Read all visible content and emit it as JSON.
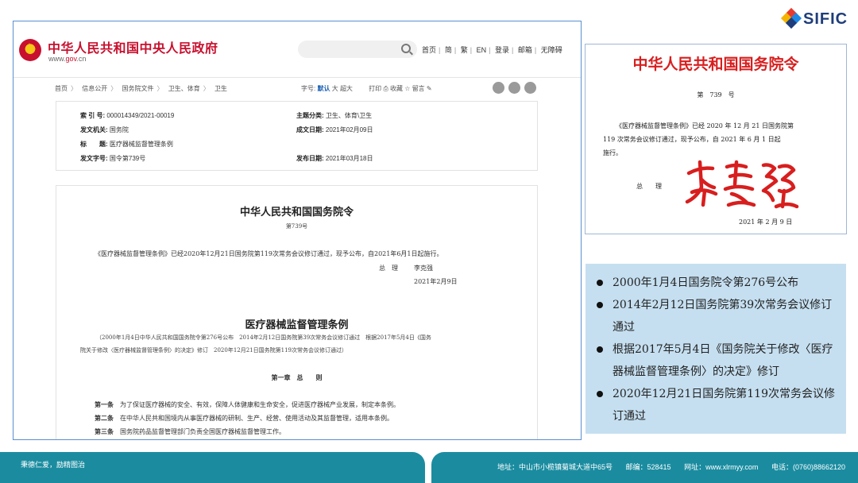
{
  "gov_site": {
    "title": "中华人民共和国中央人民政府",
    "url_prefix": "www.",
    "url_gov": "gov",
    "url_suffix": ".cn",
    "nav_links": [
      "首页",
      "简",
      "繁",
      "EN",
      "登录",
      "邮箱",
      "无障碍"
    ],
    "breadcrumbs": [
      "首页",
      "信息公开",
      "国务院文件",
      "卫生、体育",
      "卫生"
    ],
    "font_size_label": "字号:",
    "font_sizes": [
      "默认",
      "大",
      "超大"
    ],
    "tools": [
      "打印",
      "收藏",
      "留言"
    ]
  },
  "meta": {
    "index_label": "索 引 号:",
    "index_value": "000014349/2021-00019",
    "category_label": "主题分类:",
    "category_value": "卫生、体育\\卫生",
    "issuer_label": "发文机关:",
    "issuer_value": "国务院",
    "written_label": "成文日期:",
    "written_value": "2021年02月09日",
    "title_label": "标　　题:",
    "title_value": "医疗器械监督管理条例",
    "docno_label": "发文字号:",
    "docno_value": "国令第739号",
    "published_label": "发布日期:",
    "published_value": "2021年03月18日"
  },
  "document": {
    "heading": "中华人民共和国国务院令",
    "number": "第739号",
    "intro": "《医疗器械监督管理条例》已经2020年12月21日国务院第119次常务会议修订通过，现予公布，自2021年6月1日起施行。",
    "signer_label": "总　理",
    "signer_name": "李克强",
    "sign_date": "2021年2月9日",
    "regulation_title": "医疗器械监督管理条例",
    "history_line1": "（2000年1月4日中华人民共和国国务院令第276号公布　2014年2月12日国务院第39次常务会议修订通过　根据2017年5月4日《国务",
    "history_line2": "院关于修改〈医疗器械监督管理条例〉的决定》修订　2020年12月21日国务院第119次常务会议修订通过）",
    "chapter": "第一章　总　　则",
    "articles": [
      {
        "label": "第一条",
        "text": "为了保证医疗器械的安全、有效，保障人体健康和生命安全，促进医疗器械产业发展，制定本条例。"
      },
      {
        "label": "第二条",
        "text": "在中华人民共和国境内从事医疗器械的研制、生产、经营、使用活动及其监督管理，适用本条例。"
      },
      {
        "label": "第三条",
        "text": "国务院药品监督管理部门负责全国医疗器械监督管理工作。"
      }
    ]
  },
  "logo": {
    "text": "SIFIC",
    "colors": [
      "#e63b2e",
      "#f4b400",
      "#1e88e5",
      "#1e3d7a"
    ]
  },
  "decree": {
    "title": "中华人民共和国国务院令",
    "number": "第　739　号",
    "body_line1": "《医疗器械监督管理条例》已经 2020 年 12 月 21 日国务院第",
    "body_line2": "119 次常务会议修订通过，现予公布，自 2021 年 6 月 1 日起",
    "body_line3": "施行。",
    "signer_label": "总　　理",
    "date": "2021 年 2 月 9 日",
    "signature_color": "#d81e1e"
  },
  "info_panel": {
    "items": [
      {
        "text": "2000年1月4日国务院令第276号公布"
      },
      {
        "text": "2014年2月12日国务院第39次常务会议修订通过"
      },
      {
        "text": "根据2017年5月4日《国务院关于修改〈医疗器械监督管理条例〉的决定》修订"
      },
      {
        "text": "2020年12月21日国务院第119次常务会议修订通过"
      }
    ],
    "background": "#c5dff0"
  },
  "footer": {
    "slogan": "秉德仁爱，励精图治",
    "address": "地址：中山市小榄镇菊城大道中65号",
    "postcode": "邮编：528415",
    "website": "网址：www.xlrmyy.com",
    "phone": "电话：(0760)88662120",
    "color": "#1b8ca0"
  }
}
